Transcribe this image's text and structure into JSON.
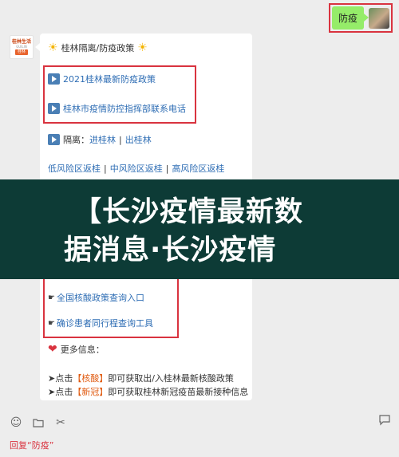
{
  "outgoing": {
    "text": "防疫"
  },
  "bot": {
    "brand": "桂林生活",
    "sub": "GUILIN",
    "tag": "桂林"
  },
  "message": {
    "title": "桂林隔离/防疫政策",
    "link1": "2021桂林最新防疫政策",
    "link2": "桂林市疫情防控指挥部联系电话",
    "isolation_label": "隔离：",
    "isolation_in": "进桂林",
    "isolation_out": "出桂林",
    "risk_low": "低风险区返桂",
    "risk_mid": "中风险区返桂",
    "risk_high": "高风险区返桂",
    "nucleic_link": "全国核酸政策查询入口",
    "trip_link": "确诊患者同行程查询工具",
    "more_info": "更多信息：",
    "bullet1_prefix": "➤点击",
    "bullet1_key": "【核酸】",
    "bullet1_rest": "即可获取出/入桂林最新核酸政策",
    "bullet2_prefix": "➤点击",
    "bullet2_key": "【新冠】",
    "bullet2_rest": "即可获取桂林新冠疫苗最新接种信息"
  },
  "banner": {
    "line1": "【长沙疫情最新数",
    "line2": "据消息·长沙疫情"
  },
  "toolbar": {
    "reply_text": "回复“防疫”"
  }
}
